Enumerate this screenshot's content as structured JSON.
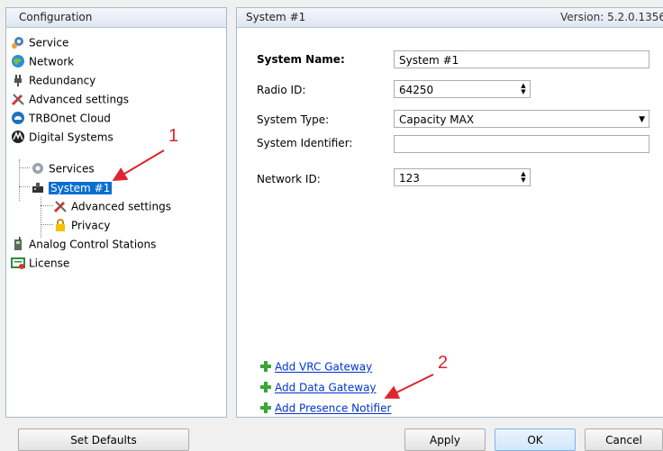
{
  "left_panel": {
    "header": "Configuration",
    "tree": [
      {
        "label": "Service",
        "icon": "gear-icon"
      },
      {
        "label": "Network",
        "icon": "globe-icon"
      },
      {
        "label": "Redundancy",
        "icon": "plug-icon"
      },
      {
        "label": "Advanced settings",
        "icon": "tools-icon"
      },
      {
        "label": "TRBOnet Cloud",
        "icon": "cloud-icon"
      },
      {
        "label": "Digital Systems",
        "icon": "motorola-icon"
      },
      {
        "label": "Services",
        "icon": "gear-icon"
      },
      {
        "label": "System #1",
        "icon": "system-icon",
        "selected": true
      },
      {
        "label": "Advanced settings",
        "icon": "tools-icon"
      },
      {
        "label": "Privacy",
        "icon": "lock-icon"
      },
      {
        "label": "Analog Control Stations",
        "icon": "radio-icon"
      },
      {
        "label": "License",
        "icon": "license-icon"
      }
    ]
  },
  "right_panel": {
    "header": "System #1",
    "version": "Version: 5.2.0.1356",
    "fields": {
      "system_name": {
        "label": "System Name:",
        "value": "System #1"
      },
      "radio_id": {
        "label": "Radio ID:",
        "value": "64250"
      },
      "system_type": {
        "label": "System Type:",
        "value": "Capacity MAX"
      },
      "system_identifier": {
        "label": "System Identifier:",
        "value": ""
      },
      "network_id": {
        "label": "Network ID:",
        "value": "123"
      }
    },
    "links": [
      {
        "label": "Add VRC Gateway"
      },
      {
        "label": "Add Data Gateway"
      },
      {
        "label": "Add Presence Notifier"
      }
    ]
  },
  "buttons": {
    "set_defaults": "Set Defaults",
    "apply": "Apply",
    "ok": "OK",
    "cancel": "Cancel"
  },
  "annotations": {
    "one": "1",
    "two": "2"
  },
  "colors": {
    "selection": "#0a6ed1",
    "link": "#0033cc",
    "annotation": "#e0232e"
  }
}
